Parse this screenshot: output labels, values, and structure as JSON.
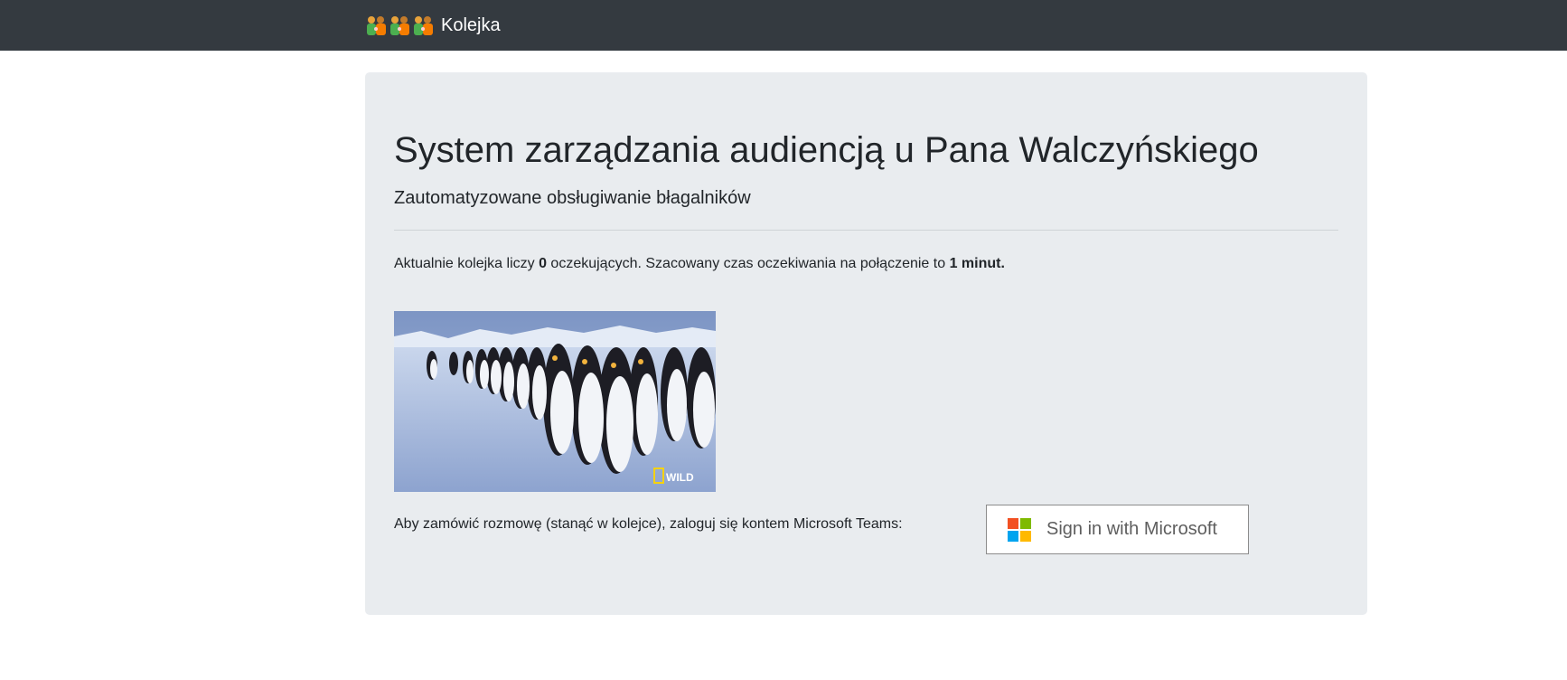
{
  "navbar": {
    "brand_text": "Kolejka",
    "brand_icons": [
      "person-icon",
      "person-icon",
      "person-icon"
    ],
    "background": "#343a40"
  },
  "jumbotron": {
    "title": "System zarządzania audiencją u Pana Walczyńskiego",
    "subtitle": "Zautomatyzowane obsługiwanie błagalników",
    "queue_text_1": "Aktualnie kolejka liczy ",
    "queue_count": "0",
    "queue_text_2": " oczekujących. Szacowany czas oczekiwania na połączenie to ",
    "wait_time": "1 minut.",
    "image_watermark": "WILD",
    "login_prompt": "Aby zamówić rozmowę (stanąć w kolejce), zaloguj się kontem Microsoft Teams:",
    "background": "#e9ecef"
  },
  "sign_in_button": {
    "label": "Sign in with Microsoft",
    "logo_colors": [
      "#f25022",
      "#7fba00",
      "#00a4ef",
      "#ffb900"
    ]
  }
}
